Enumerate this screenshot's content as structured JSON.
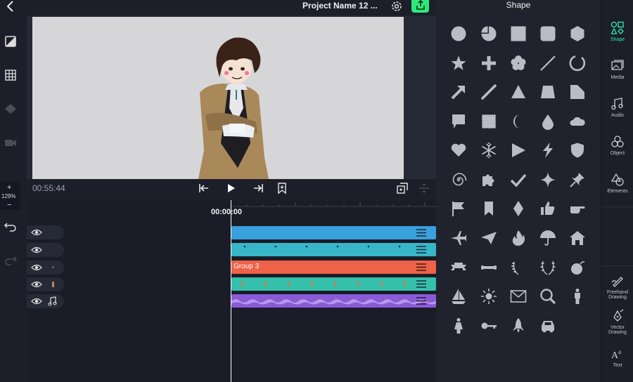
{
  "topbar": {
    "project_title": "Project Name 12 ..."
  },
  "zoom": {
    "plus": "+",
    "value": "129%",
    "minus": "−"
  },
  "transport": {
    "elapsed": "00:55:44"
  },
  "timeline": {
    "playhead_time": "00:00:00",
    "tracks": [
      {
        "color": "#3aa0dc",
        "label": ""
      },
      {
        "color": "#37b6c8",
        "label": ""
      },
      {
        "color": "#ee6247",
        "label": "Group 3"
      },
      {
        "color": "#35c0ac",
        "label": ""
      },
      {
        "color": "#8a5bd6",
        "label": ""
      }
    ]
  },
  "panel": {
    "title": "Shape"
  },
  "rightbar": {
    "tabs": [
      {
        "label": "Shape",
        "icon": "shape-icon"
      },
      {
        "label": "Media",
        "icon": "media-icon"
      },
      {
        "label": "Audio",
        "icon": "audio-icon"
      },
      {
        "label": "Object",
        "icon": "object-icon"
      },
      {
        "label": "Elements",
        "icon": "elements-icon"
      }
    ],
    "bottom_tabs": [
      {
        "label_1": "Freehand",
        "label_2": "Drawing",
        "icon": "freehand-drawing-icon"
      },
      {
        "label_1": "Vector",
        "label_2": "Drawing",
        "icon": "vector-drawing-icon"
      },
      {
        "label_1": "Text",
        "icon": "text-icon"
      }
    ]
  },
  "colors": {
    "accent": "#2ee87b",
    "panel_bg": "#20232e",
    "shape_fill": "#b9bcc4"
  }
}
